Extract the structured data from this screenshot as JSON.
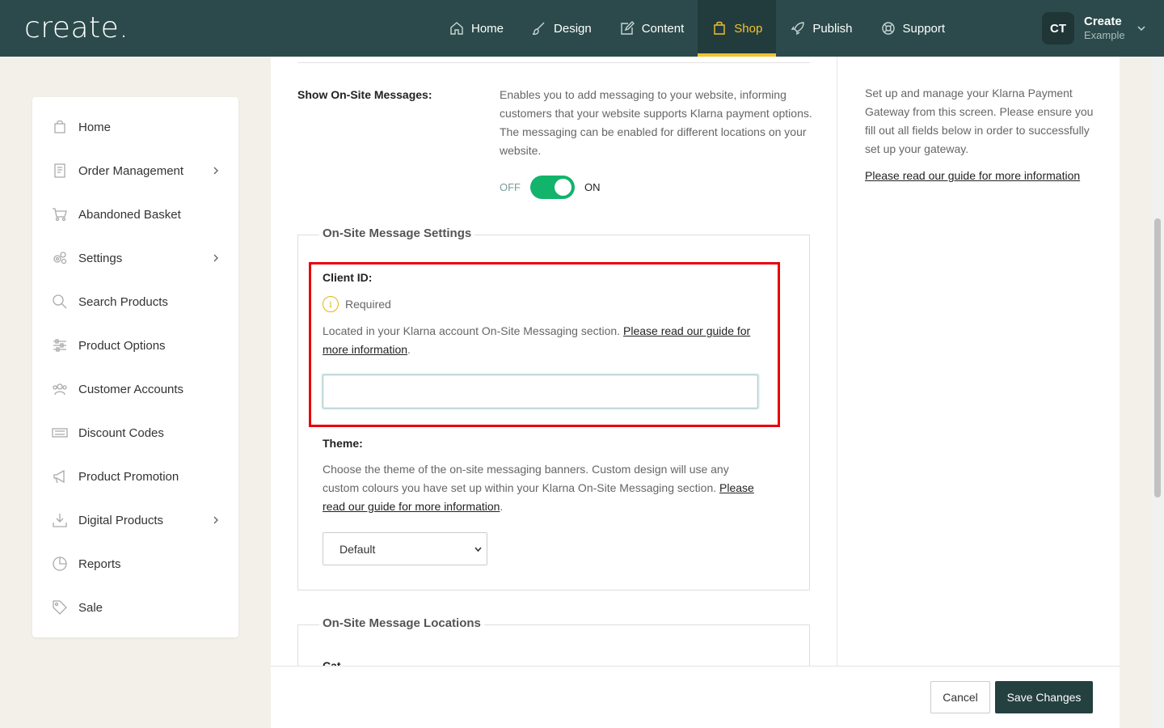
{
  "brand": {
    "logo": "create",
    "logo_dot": "."
  },
  "nav": {
    "items": [
      {
        "label": "Home",
        "icon": "home-icon"
      },
      {
        "label": "Design",
        "icon": "brush-icon"
      },
      {
        "label": "Content",
        "icon": "edit-icon"
      },
      {
        "label": "Shop",
        "icon": "bag-icon",
        "active": true
      },
      {
        "label": "Publish",
        "icon": "rocket-icon"
      },
      {
        "label": "Support",
        "icon": "lifebuoy-icon"
      }
    ],
    "user": {
      "initials": "CT",
      "name": "Create",
      "site": "Example"
    }
  },
  "sidebar": {
    "items": [
      {
        "label": "Home",
        "icon": "bag-icon"
      },
      {
        "label": "Order Management",
        "icon": "document-icon",
        "has_submenu": true
      },
      {
        "label": "Abandoned Basket",
        "icon": "cart-icon"
      },
      {
        "label": "Settings",
        "icon": "gears-icon",
        "has_submenu": true
      },
      {
        "label": "Search Products",
        "icon": "search-icon"
      },
      {
        "label": "Product Options",
        "icon": "sliders-icon"
      },
      {
        "label": "Customer Accounts",
        "icon": "users-icon"
      },
      {
        "label": "Discount Codes",
        "icon": "ticket-icon"
      },
      {
        "label": "Product Promotion",
        "icon": "megaphone-icon"
      },
      {
        "label": "Digital Products",
        "icon": "download-icon",
        "has_submenu": true
      },
      {
        "label": "Reports",
        "icon": "pie-chart-icon"
      },
      {
        "label": "Sale",
        "icon": "tag-icon"
      }
    ]
  },
  "form": {
    "show_messages": {
      "label": "Show On-Site Messages:",
      "description": "Enables you to add messaging to your website, informing customers that your website supports Klarna payment options. The messaging can be enabled for different locations on your website.",
      "toggle_off": "OFF",
      "toggle_on": "ON",
      "enabled": true
    },
    "settings_section": {
      "legend": "On-Site Message Settings",
      "client_id": {
        "label": "Client ID:",
        "required": "Required",
        "description": "Located in your Klarna account On-Site Messaging section.",
        "link": "Please read our guide for more information",
        "value": ""
      },
      "theme": {
        "label": "Theme:",
        "description": "Choose the theme of the on-site messaging banners. Custom design will use any custom colours you have set up within your Klarna On-Site Messaging section.",
        "link": "Please read our guide for more information",
        "selected": "Default"
      }
    },
    "locations_section": {
      "legend": "On-Site Message Locations",
      "first_label": "Cat..."
    }
  },
  "info_panel": {
    "text": "Set up and manage your Klarna Payment Gateway from this screen. Please ensure you fill out all fields below in order to successfully set up your gateway.",
    "link": "Please read our guide for more information"
  },
  "footer": {
    "cancel": "Cancel",
    "save": "Save Changes"
  },
  "colors": {
    "nav_bg": "#2c4a4b",
    "active": "#f2c230",
    "toggle": "#12b36b",
    "highlight": "#e8000b",
    "save_btn": "#24403f"
  }
}
